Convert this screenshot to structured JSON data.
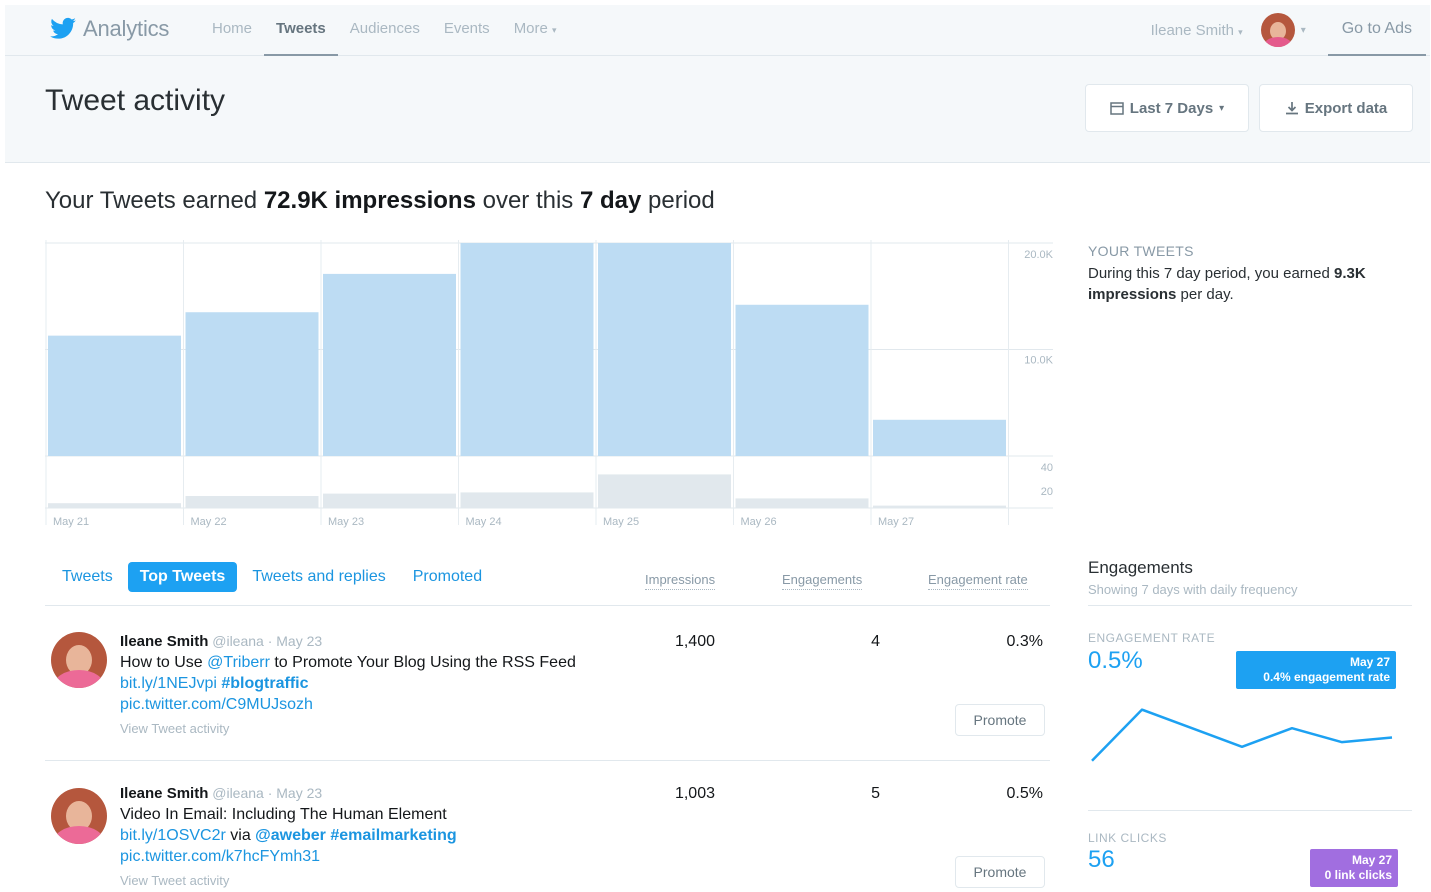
{
  "nav": {
    "brand": "Analytics",
    "items": [
      {
        "label": "Home",
        "active": false
      },
      {
        "label": "Tweets",
        "active": true
      },
      {
        "label": "Audiences",
        "active": false
      },
      {
        "label": "Events",
        "active": false
      },
      {
        "label": "More",
        "active": false
      }
    ],
    "username": "Ileane Smith",
    "go_to_ads": "Go to Ads"
  },
  "header": {
    "title": "Tweet activity",
    "range_label": "Last 7 Days",
    "export_label": "Export data"
  },
  "summary": {
    "prefix": "Your Tweets earned ",
    "impressions": "72.9K impressions",
    "middle": " over this ",
    "period": "7 day",
    "suffix": " period"
  },
  "chart_data": {
    "type": "bar",
    "categories": [
      "May 21",
      "May 22",
      "May 23",
      "May 24",
      "May 25",
      "May 26",
      "May 27"
    ],
    "series": [
      {
        "values": [
          11300,
          13500,
          17100,
          20000,
          20000,
          14200,
          3400
        ]
      },
      {
        "values": [
          4,
          10,
          12,
          13,
          28,
          8,
          2
        ]
      }
    ],
    "y_ticks_upper": [
      "20.0K",
      "10.0K"
    ],
    "y_ticks_lower": [
      "40",
      "20"
    ],
    "colors": {
      "primary": "#bddcf3",
      "secondary": "#e1e8ed"
    }
  },
  "side": {
    "heading": "YOUR TWEETS",
    "text_a": "During this 7 day period, you earned ",
    "text_bold": "9.3K impressions",
    "text_b": " per day."
  },
  "tabs": [
    {
      "label": "Tweets",
      "active": false
    },
    {
      "label": "Top Tweets",
      "active": true
    },
    {
      "label": "Tweets and replies",
      "active": false
    },
    {
      "label": "Promoted",
      "active": false
    }
  ],
  "columns": {
    "impressions": "Impressions",
    "engagements": "Engagements",
    "rate": "Engagement rate"
  },
  "tweets": [
    {
      "name": "Ileane Smith",
      "meta": "@ileana · May 23",
      "t1": "How to Use ",
      "mention": "@Triberr",
      "t2": " to Promote Your Blog Using the RSS Feed ",
      "link": "bit.ly/1NEJvpi",
      "hashtag": "#blogtraffic",
      "pic": "pic.twitter.com/C9MUJsozh",
      "view": "View Tweet activity",
      "impressions": "1,400",
      "engagements": "4",
      "rate": "0.3%",
      "promote": "Promote"
    },
    {
      "name": "Ileane Smith",
      "meta": "@ileana · May 23",
      "t1": "Video In Email: Including The Human Element",
      "link": "bit.ly/1OSVC2r",
      "via": " via ",
      "mention": "@aweber",
      "hashtag": "#emailmarketing",
      "pic": "pic.twitter.com/k7hcFYmh31",
      "view": "View Tweet activity",
      "impressions": "1,003",
      "engagements": "5",
      "rate": "0.5%",
      "promote": "Promote"
    }
  ],
  "engagements": {
    "title": "Engagements",
    "subtitle": "Showing 7 days with daily frequency",
    "rate_label": "ENGAGEMENT RATE",
    "rate_value": "0.5%",
    "rate_tooltip_date": "May 27",
    "rate_tooltip_text": "0.4% engagement rate",
    "rate_series": [
      0.2,
      1.3,
      0.9,
      0.5,
      0.9,
      0.6,
      0.7
    ],
    "clicks_label": "LINK CLICKS",
    "clicks_value": "56",
    "clicks_tooltip_date": "May 27",
    "clicks_tooltip_text": "0 link clicks"
  }
}
